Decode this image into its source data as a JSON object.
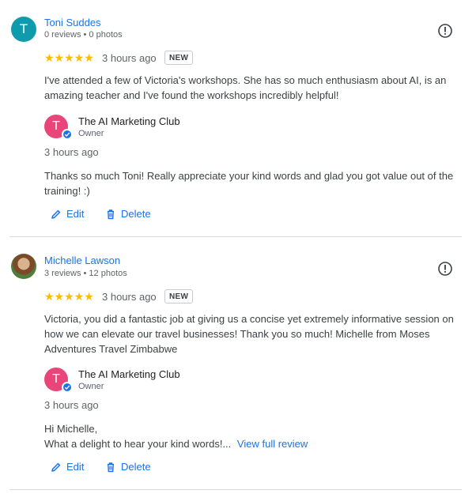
{
  "colors": {
    "accent": "#1a73e8",
    "star": "#fbbc04",
    "owner_avatar_bg": "#e8457a",
    "reviewer1_avatar_bg": "#0f9bab"
  },
  "reviews": [
    {
      "reviewer_name": "Toni Suddes",
      "reviewer_initial": "T",
      "reviewer_meta": "0 reviews • 0 photos",
      "stars": "★★★★★",
      "rating": 5,
      "time": "3 hours ago",
      "badge": "NEW",
      "text": "I've attended a few of Victoria's workshops. She has so much enthusiasm about AI, is an amazing teacher and I've found the workshops incredibly helpful!",
      "reply": {
        "owner_initial": "T",
        "owner_name": "The AI Marketing Club",
        "owner_role": "Owner",
        "time": "3 hours ago",
        "text": "Thanks so much Toni! Really appreciate your kind words and glad you got value out of the training! :)"
      },
      "edit_label": "Edit",
      "delete_label": "Delete"
    },
    {
      "reviewer_name": "Michelle Lawson",
      "reviewer_meta": "3 reviews • 12 photos",
      "stars": "★★★★★",
      "rating": 5,
      "time": "3 hours ago",
      "badge": "NEW",
      "text": "Victoria, you did a fantastic job at giving us a concise yet extremely informative session on how we can elevate our travel businesses! Thank you so much! Michelle from Moses Adventures Travel Zimbabwe",
      "reply": {
        "owner_initial": "T",
        "owner_name": "The AI Marketing Club",
        "owner_role": "Owner",
        "time": "3 hours ago",
        "text_line1": "Hi Michelle,",
        "text_line2": "What a delight to hear your kind words!...",
        "view_full": "View full review"
      },
      "edit_label": "Edit",
      "delete_label": "Delete"
    }
  ]
}
